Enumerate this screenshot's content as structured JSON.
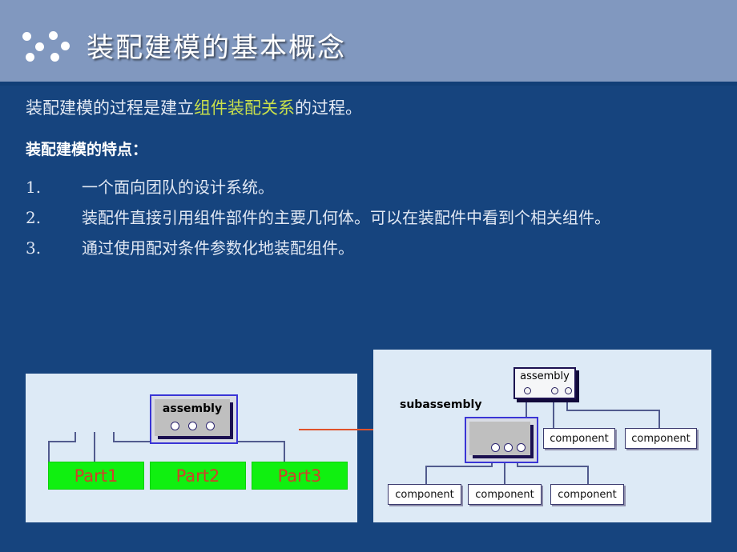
{
  "slide": {
    "header": {
      "title": "装配建模的基本概念",
      "bullet_decoration_icon": "six-dots-icon",
      "background_color": "#8198bf",
      "underline_color": "#123f77"
    },
    "background_color": "#16447e",
    "content": {
      "lead_prefix": "装配建模的过程是建立",
      "lead_highlight": "组件装配关系",
      "lead_suffix": "的过程。",
      "highlight_color": "#c9e04b",
      "subhead": "装配建模的特点：",
      "points": [
        {
          "num": "1.",
          "text": "一个面向团队的设计系统。"
        },
        {
          "num": "2.",
          "text": "装配件直接引用组件部件的主要几何体。可以在装配件中看到个相关组件。"
        },
        {
          "num": "3.",
          "text": "通过使用配对条件参数化地装配组件。"
        }
      ]
    },
    "diagram_left": {
      "panel_background": "#ddeaf6",
      "assembly_label": "assembly",
      "ports": 3,
      "parts": [
        "Part1",
        "Part2",
        "Part3"
      ],
      "part_fill_color": "#10f010",
      "part_text_color": "#d0402a"
    },
    "transition_arrow": {
      "icon": "right-arrow-icon",
      "color": "#e0522a"
    },
    "diagram_right": {
      "panel_background": "#ddeaf6",
      "assembly_label": "assembly",
      "subassembly_label": "subassembly",
      "assembly_ports": 3,
      "subassembly_ports": 3,
      "components_upper": [
        "component",
        "component"
      ],
      "components_lower": [
        "component",
        "component",
        "component"
      ]
    }
  }
}
